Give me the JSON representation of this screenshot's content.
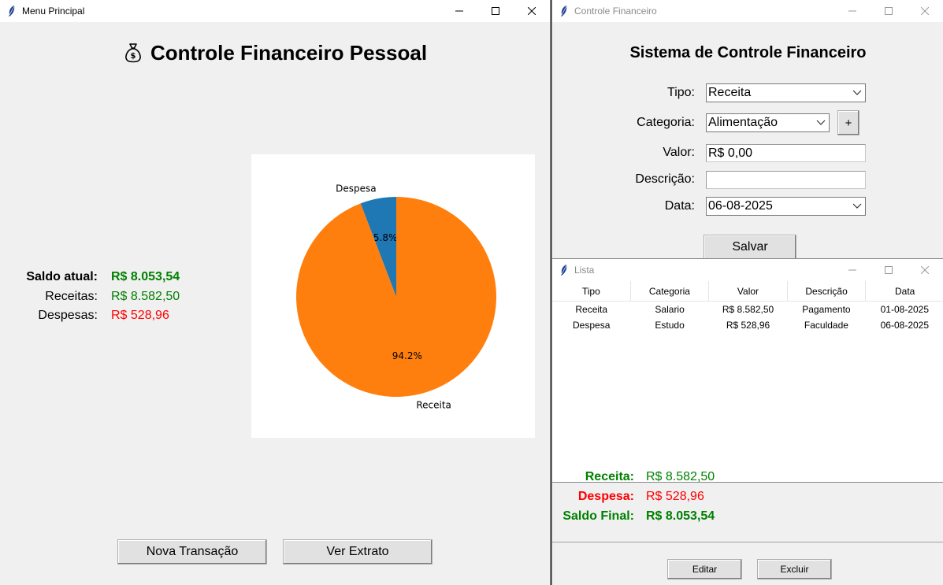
{
  "menu_window": {
    "title": "Menu Principal",
    "heading": "Controle Financeiro Pessoal",
    "summary": {
      "saldo_label": "Saldo atual:",
      "saldo_value": "R$ 8.053,54",
      "receitas_label": "Receitas:",
      "receitas_value": "R$ 8.582,50",
      "despesas_label": "Despesas:",
      "despesas_value": "R$ 528,96"
    },
    "buttons": {
      "nova": "Nova Transação",
      "extrato": "Ver Extrato"
    }
  },
  "chart_data": {
    "type": "pie",
    "categories": [
      "Despesa",
      "Receita"
    ],
    "values": [
      528.96,
      8582.5
    ],
    "percent_labels": [
      "5.8%",
      "94.2%"
    ],
    "colors": [
      "#1f77b4",
      "#ff7f0e"
    ]
  },
  "form_window": {
    "title": "Controle Financeiro",
    "heading": "Sistema de Controle Financeiro",
    "labels": {
      "tipo": "Tipo:",
      "categoria": "Categoria:",
      "valor": "Valor:",
      "descricao": "Descrição:",
      "data": "Data:"
    },
    "values": {
      "tipo": "Receita",
      "categoria": "Alimentação",
      "valor": "R$ 0,00",
      "descricao": "",
      "data": "06-08-2025"
    },
    "add_category_button": "+",
    "save_button": "Salvar"
  },
  "list_window": {
    "title": "Lista",
    "columns": [
      "Tipo",
      "Categoria",
      "Valor",
      "Descrição",
      "Data"
    ],
    "rows": [
      [
        "Receita",
        "Salario",
        "R$ 8.582,50",
        "Pagamento",
        "01-08-2025"
      ],
      [
        "Despesa",
        "Estudo",
        "R$ 528,96",
        "Faculdade",
        "06-08-2025"
      ]
    ],
    "totals": {
      "receita_label": "Receita:",
      "receita_value": "R$ 8.582,50",
      "despesa_label": "Despesa:",
      "despesa_value": "R$ 528,96",
      "saldo_label": "Saldo Final:",
      "saldo_value": "R$ 8.053,54"
    },
    "buttons": {
      "editar": "Editar",
      "excluir": "Excluir"
    }
  },
  "colors": {
    "positive": "#008000",
    "negative": "#ff0000"
  }
}
